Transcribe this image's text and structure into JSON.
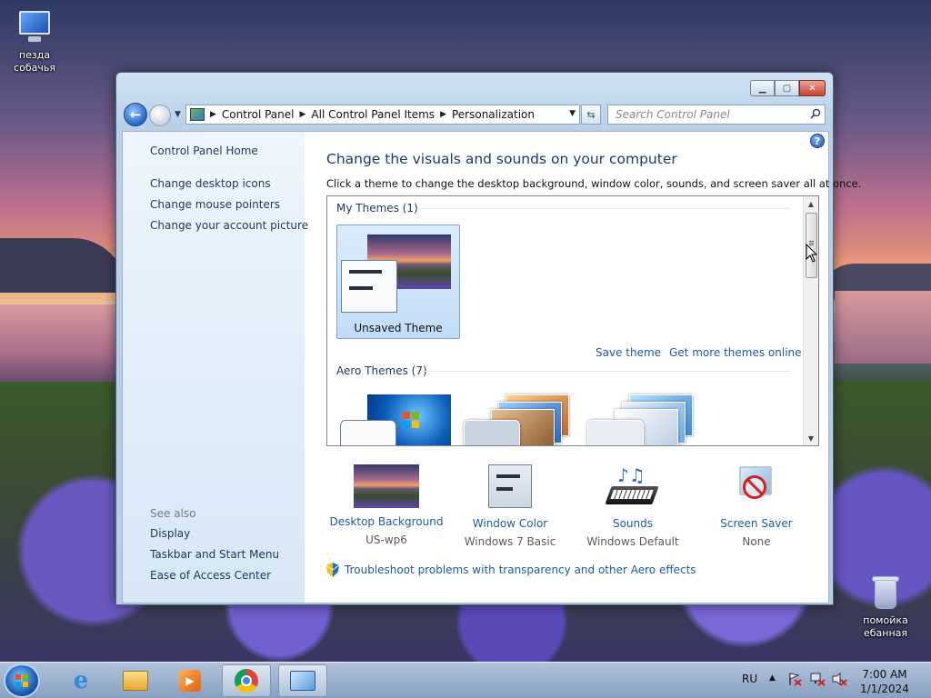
{
  "desktop": {
    "icons": [
      {
        "label_line1": "пезда",
        "label_line2": "собачья"
      },
      {
        "label_line1": "помойка",
        "label_line2": "ебанная"
      }
    ]
  },
  "window": {
    "controls": {
      "minimize": "▁",
      "maximize": "▢",
      "close": "✕"
    }
  },
  "address": {
    "crumbs": [
      "Control Panel",
      "All Control Panel Items",
      "Personalization"
    ],
    "separator": "▶"
  },
  "search": {
    "placeholder": "Search Control Panel"
  },
  "left_pane": {
    "home": "Control Panel Home",
    "links": [
      "Change desktop icons",
      "Change mouse pointers",
      "Change your account picture"
    ],
    "see_also": "See also",
    "see_also_links": [
      "Display",
      "Taskbar and Start Menu",
      "Ease of Access Center"
    ]
  },
  "main": {
    "help": "?",
    "title": "Change the visuals and sounds on your computer",
    "subtitle": "Click a theme to change the desktop background, window color, sounds, and screen saver all at once.",
    "my_themes_header": "My Themes (1)",
    "unsaved_theme": "Unsaved Theme",
    "save_theme": "Save theme",
    "get_more": "Get more themes online",
    "aero_header": "Aero Themes (7)"
  },
  "bottom": [
    {
      "label": "Desktop Background",
      "value": "US-wp6"
    },
    {
      "label": "Window Color",
      "value": "Windows 7 Basic"
    },
    {
      "label": "Sounds",
      "value": "Windows Default"
    },
    {
      "label": "Screen Saver",
      "value": "None"
    }
  ],
  "troubleshoot": "Troubleshoot problems with transparency and other Aero effects",
  "taskbar": {
    "language": "RU",
    "time": "7:00 AM",
    "date": "1/1/2024"
  }
}
